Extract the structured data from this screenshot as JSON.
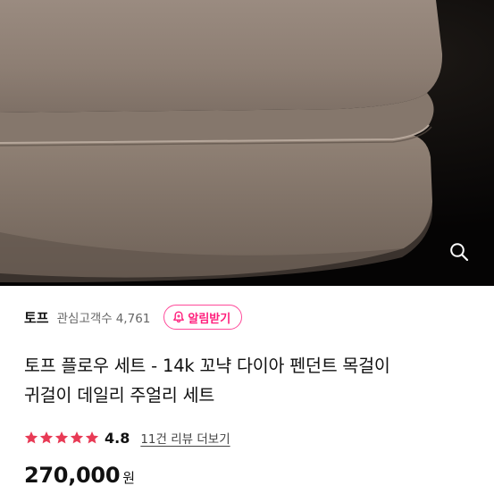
{
  "product_image": {
    "alt": ""
  },
  "seller": {
    "name": "토프",
    "followers_label": "관심고객수",
    "followers_count": "4,761",
    "alarm_label": "알림받기"
  },
  "product": {
    "title_line1": "토프 플로우 세트 - 14k 꼬냑 다이아 펜던트 목걸이",
    "title_line2": "귀걸이 데일리 주얼리 세트"
  },
  "rating": {
    "value": "4.8",
    "stars": 5,
    "reviews_link": "11건 리뷰 더보기"
  },
  "price": {
    "amount": "270,000",
    "currency": "원"
  },
  "colors": {
    "accent_pink": "#ff1f7c",
    "star_red": "#e83a55",
    "box_taupe": "#8c7d72"
  },
  "icons": {
    "zoom": "search-icon",
    "alarm": "bell-icon",
    "star": "star-icon"
  }
}
